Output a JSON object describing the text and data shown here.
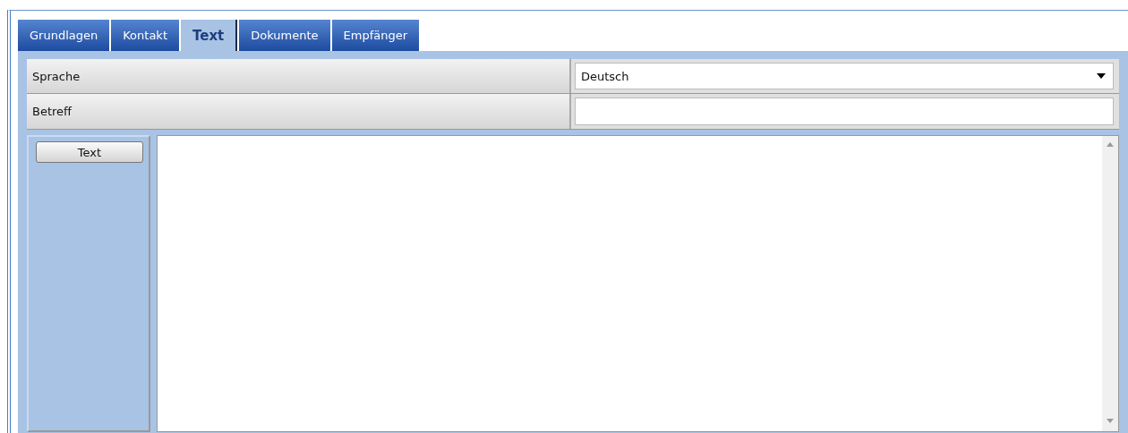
{
  "tabs": [
    {
      "label": "Grundlagen",
      "selected": false
    },
    {
      "label": "Kontakt",
      "selected": false
    },
    {
      "label": "Text",
      "selected": true
    },
    {
      "label": "Dokumente",
      "selected": false
    },
    {
      "label": "Empfänger",
      "selected": false
    }
  ],
  "fields": [
    {
      "label": "Sprache",
      "kind": "select",
      "value": "Deutsch"
    },
    {
      "label": "Betreff",
      "kind": "text"
    }
  ],
  "editor": {
    "button": "Text"
  }
}
